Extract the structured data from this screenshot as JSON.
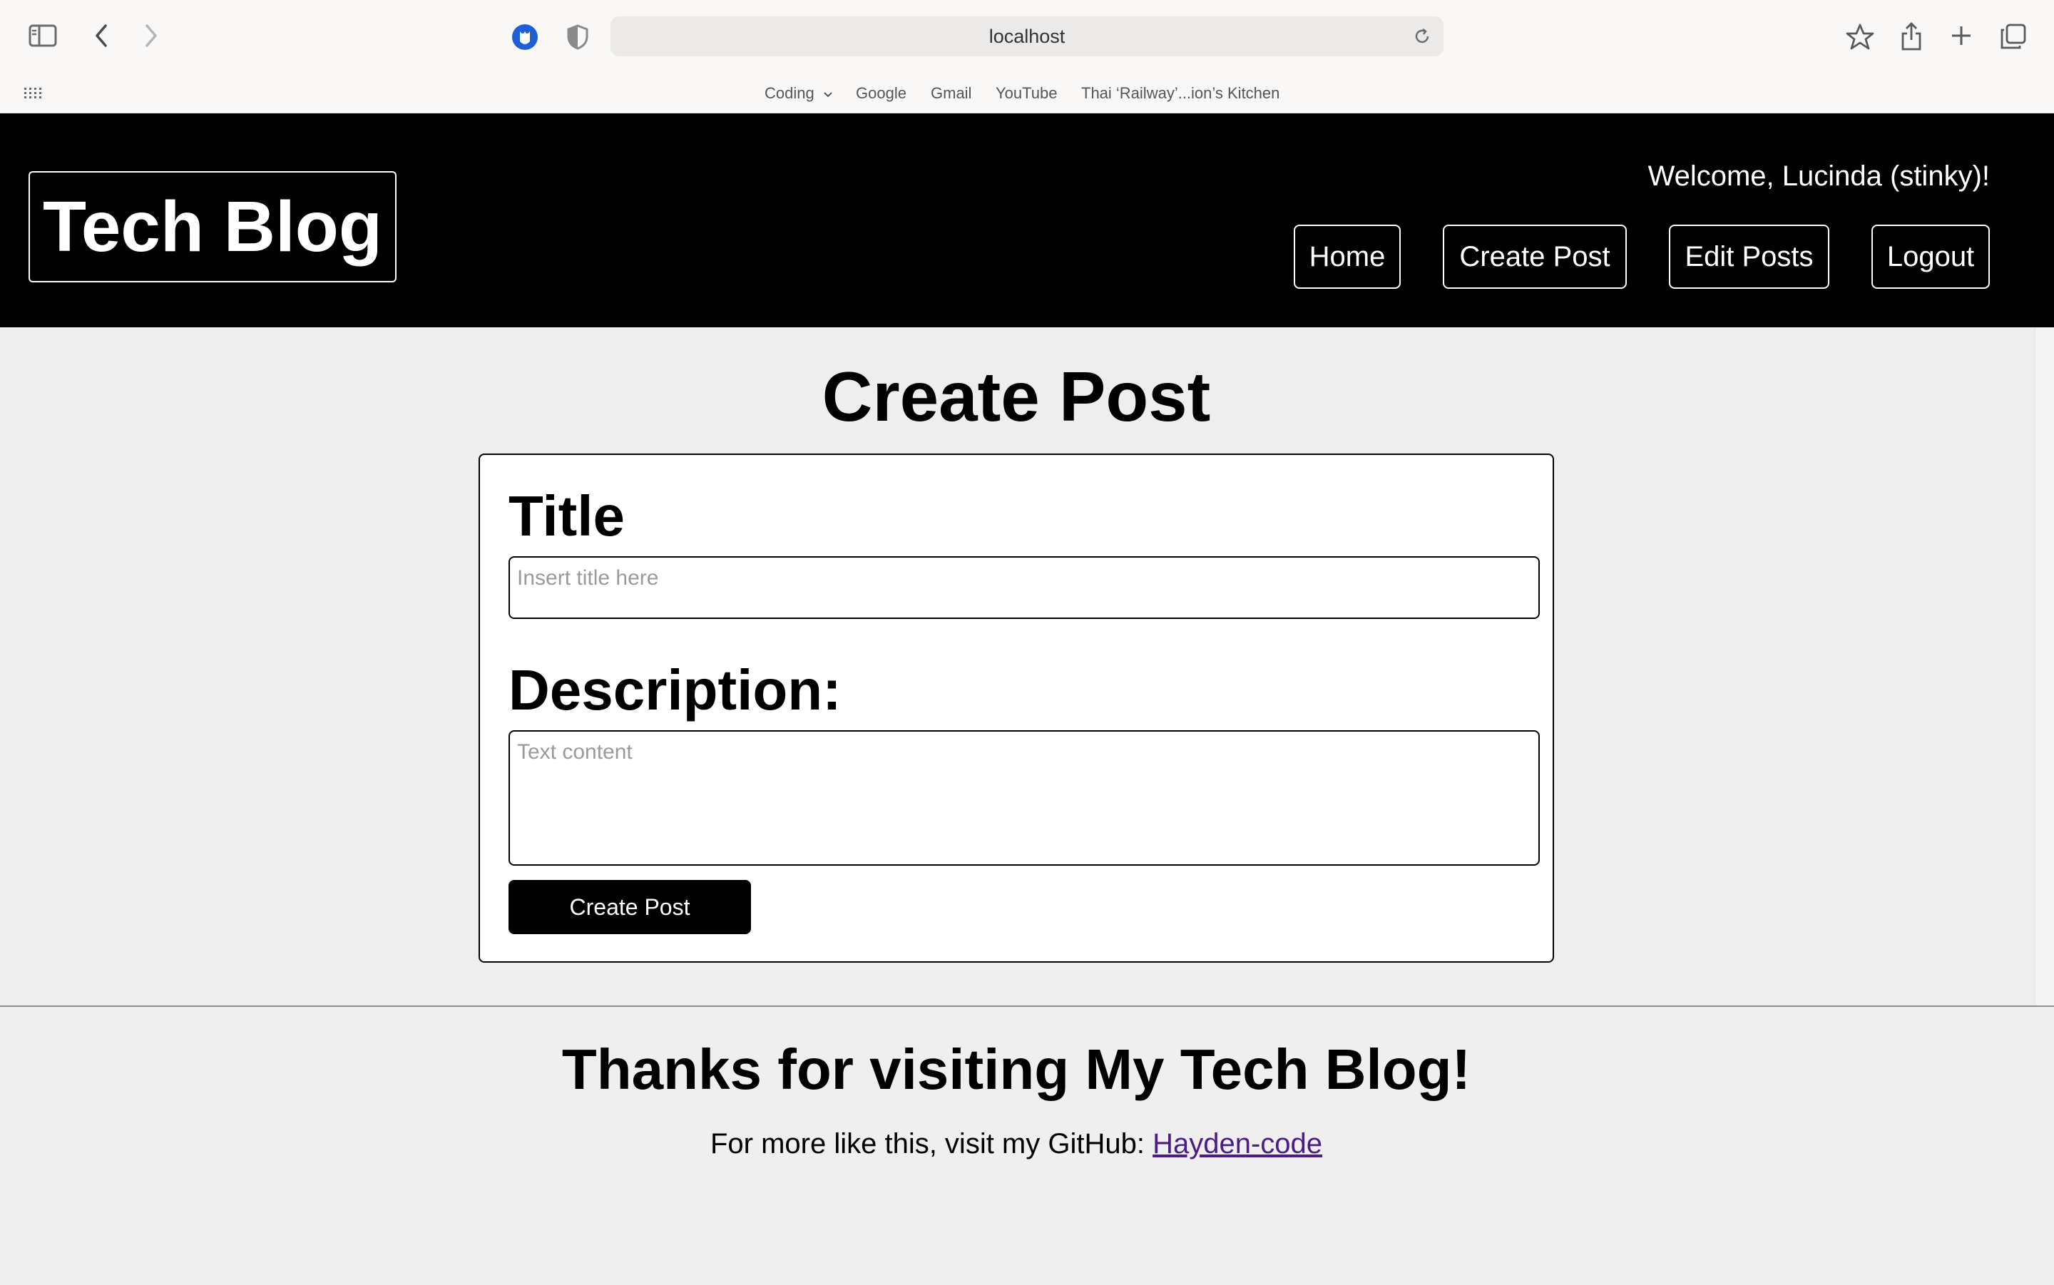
{
  "browser": {
    "url": "localhost",
    "bookmarks": [
      "Coding",
      "Google",
      "Gmail",
      "YouTube",
      "Thai ‘Railway’...ion’s Kitchen"
    ],
    "icons": [
      "sidebar-icon",
      "back-icon",
      "forward-icon",
      "extension-icon",
      "shield-icon",
      "reload-icon",
      "bookmark-star-icon",
      "share-icon",
      "new-tab-icon",
      "tab-overview-icon",
      "apps-grid-icon"
    ]
  },
  "header": {
    "logo": "Tech Blog",
    "welcome": "Welcome, Lucinda (stinky)!",
    "nav": [
      "Home",
      "Create Post",
      "Edit Posts",
      "Logout"
    ]
  },
  "main": {
    "title": "Create Post",
    "form": {
      "title_label": "Title",
      "title_placeholder": "Insert title here",
      "title_value": "",
      "description_label": "Description:",
      "description_placeholder": "Text content",
      "description_value": "",
      "submit_label": "Create Post"
    }
  },
  "footer": {
    "heading": "Thanks for visiting My Tech Blog!",
    "text": "For more like this, visit my GitHub: ",
    "link": "Hayden-code"
  },
  "colors": {
    "header_bg": "#000000",
    "page_bg": "#eeeeee",
    "link": "#4b1d86"
  }
}
